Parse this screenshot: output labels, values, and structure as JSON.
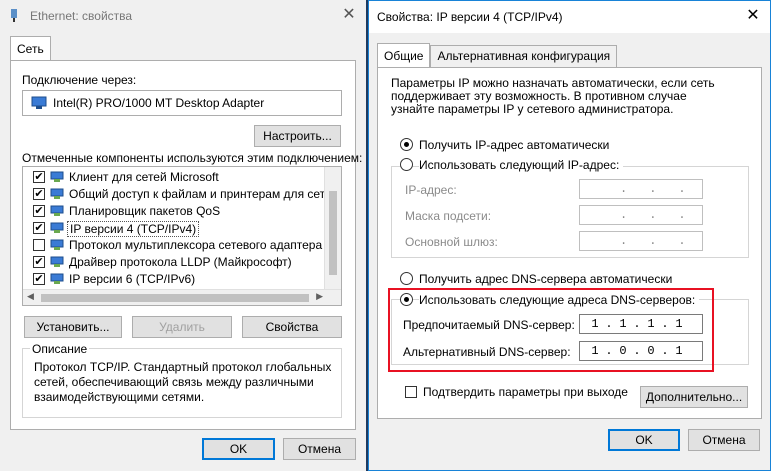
{
  "left_window": {
    "title": "Ethernet: свойства",
    "tab": "Сеть",
    "connect_via_label": "Подключение через:",
    "adapter_name": "Intel(R) PRO/1000 MT Desktop Adapter",
    "configure_button": "Настроить...",
    "components_label": "Отмеченные компоненты используются этим подключением:",
    "components": [
      {
        "label": "Клиент для сетей Microsoft",
        "checked": true,
        "selected": false
      },
      {
        "label": "Общий доступ к файлам и принтерам для сетей Mi",
        "checked": true,
        "selected": false
      },
      {
        "label": "Планировщик пакетов QoS",
        "checked": true,
        "selected": false
      },
      {
        "label": "IP версии 4 (TCP/IPv4)",
        "checked": true,
        "selected": true
      },
      {
        "label": "Протокол мультиплексора сетевого адаптера (Май",
        "checked": false,
        "selected": false
      },
      {
        "label": "Драйвер протокола LLDP (Майкрософт)",
        "checked": true,
        "selected": false
      },
      {
        "label": "IP версии 6 (TCP/IPv6)",
        "checked": true,
        "selected": false
      }
    ],
    "install_button": "Установить...",
    "remove_button": "Удалить",
    "properties_button": "Свойства",
    "description_heading": "Описание",
    "description_text": "Протокол TCP/IP. Стандартный протокол глобальных сетей, обеспечивающий связь между различными взаимодействующими сетями.",
    "ok_button": "OK",
    "cancel_button": "Отмена"
  },
  "right_window": {
    "title": "Свойства: IP версии 4 (TCP/IPv4)",
    "tabs": [
      "Общие",
      "Альтернативная конфигурация"
    ],
    "intro_text": "Параметры IP можно назначать автоматически, если сеть поддерживает эту возможность. В противном случае узнайте параметры IP у сетевого администратора.",
    "ip_auto_label": "Получить IP-адрес автоматически",
    "ip_manual_label": "Использовать следующий IP-адрес:",
    "ip_address_label": "IP-адрес:",
    "subnet_mask_label": "Маска подсети:",
    "gateway_label": "Основной шлюз:",
    "empty_ip": [
      ".",
      ".",
      "."
    ],
    "dns_auto_label": "Получить адрес DNS-сервера автоматически",
    "dns_manual_label": "Использовать следующие адреса DNS-серверов:",
    "preferred_dns_label": "Предпочитаемый DNS-сервер:",
    "preferred_dns": [
      "1",
      ".",
      "1",
      ".",
      "1",
      ".",
      "1"
    ],
    "alternate_dns_label": "Альтернативный DNS-сервер:",
    "alternate_dns": [
      "1",
      ".",
      "0",
      ".",
      "0",
      ".",
      "1"
    ],
    "validate_label": "Подтвердить параметры при выходе",
    "advanced_button": "Дополнительно...",
    "ok_button": "OK",
    "cancel_button": "Отмена",
    "highlight_color": "#e81123"
  }
}
